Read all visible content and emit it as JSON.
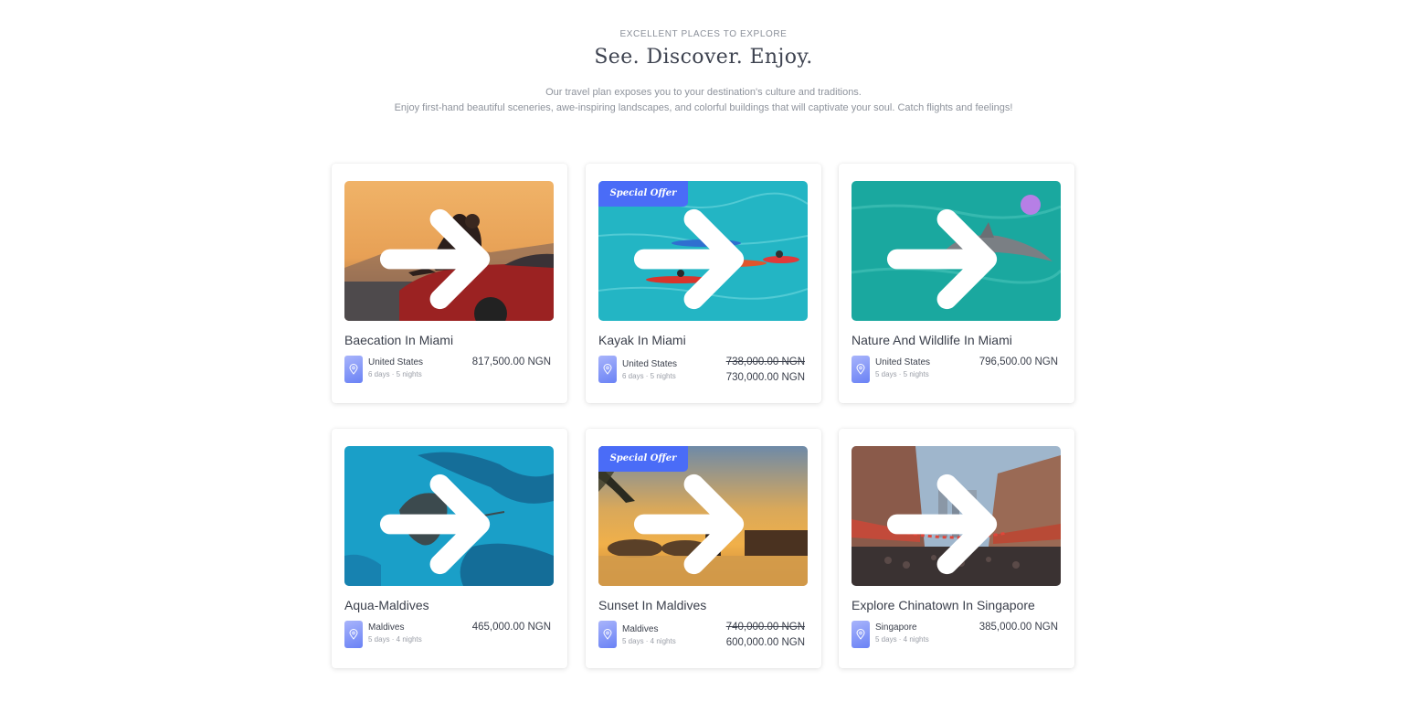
{
  "header": {
    "eyebrow": "EXCELLENT PLACES TO EXPLORE",
    "title": "See. Discover. Enjoy.",
    "subtitle_line1": "Our travel plan exposes you to your destination's culture and traditions.",
    "subtitle_line2": "Enjoy first-hand beautiful sceneries, awe-inspiring landscapes, and colorful buildings that will captivate your soul. Catch flights and feelings!"
  },
  "cards": [
    {
      "title": "Baecation In Miami",
      "location": "United States",
      "duration": "6 days · 5 nights",
      "price": "817,500.00 NGN",
      "image": "sunset-couple-car",
      "icon": "arrow-right-icon"
    },
    {
      "title": "Kayak In Miami",
      "location": "United States",
      "duration": "6 days · 5 nights",
      "old_price": "738,000.00 NGN",
      "price": "730,000.00 NGN",
      "badge": "Special Offer",
      "image": "kayaks-turquoise-water",
      "icon": "arrow-right-icon"
    },
    {
      "title": "Nature And Wildlife In Miami",
      "location": "United States",
      "duration": "5 days · 5 nights",
      "price": "796,500.00 NGN",
      "image": "dolphin-jumping",
      "icon": "arrow-right-icon"
    },
    {
      "title": "Aqua-Maldives",
      "location": "Maldives",
      "duration": "5 days · 4 nights",
      "price": "465,000.00 NGN",
      "image": "stingray-blue-water",
      "icon": "arrow-right-icon"
    },
    {
      "title": "Sunset In Maldives",
      "location": "Maldives",
      "duration": "5 days · 4 nights",
      "old_price": "740,000.00 NGN",
      "price": "600,000.00 NGN",
      "badge": "Special Offer",
      "image": "couple-sunset-beach",
      "icon": "arrow-right-icon"
    },
    {
      "title": "Explore Chinatown In Singapore",
      "location": "Singapore",
      "duration": "5 days · 4 nights",
      "price": "385,000.00 NGN",
      "image": "chinatown-street",
      "icon": "arrow-right-icon"
    }
  ],
  "colors": {
    "accent": "#4a6cf7",
    "pin_light": "#a8b4fb",
    "pin_dark": "#6a82f5",
    "text": "#3a3f4b",
    "muted": "#8e939c"
  }
}
